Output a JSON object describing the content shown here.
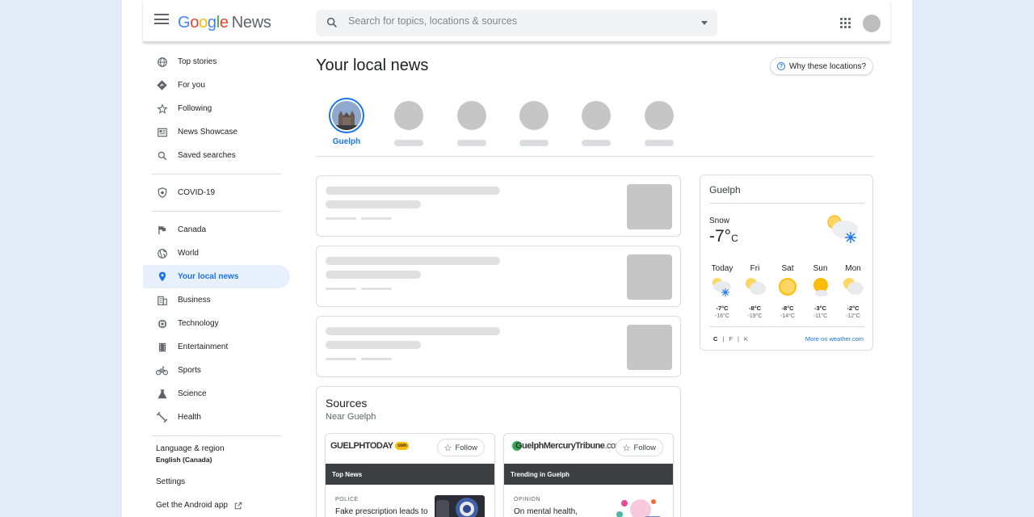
{
  "header": {
    "logo_letters": [
      "G",
      "o",
      "o",
      "g",
      "l",
      "e"
    ],
    "logo_suffix": "News",
    "search_placeholder": "Search for topics, locations & sources"
  },
  "sidebar": {
    "items": [
      {
        "label": "Top stories",
        "icon": "globe-icon"
      },
      {
        "label": "For you",
        "icon": "diamond-icon"
      },
      {
        "label": "Following",
        "icon": "star-icon"
      },
      {
        "label": "News Showcase",
        "icon": "newspaper-icon"
      },
      {
        "label": "Saved searches",
        "icon": "search-icon"
      }
    ],
    "covid": {
      "label": "COVID-19",
      "icon": "shield-icon"
    },
    "sections": [
      {
        "label": "Canada",
        "icon": "flag-icon"
      },
      {
        "label": "World",
        "icon": "world-icon"
      },
      {
        "label": "Your local news",
        "icon": "location-pin-icon",
        "active": true
      },
      {
        "label": "Business",
        "icon": "building-icon"
      },
      {
        "label": "Technology",
        "icon": "chip-icon"
      },
      {
        "label": "Entertainment",
        "icon": "film-icon"
      },
      {
        "label": "Sports",
        "icon": "bike-icon"
      },
      {
        "label": "Science",
        "icon": "flask-icon"
      },
      {
        "label": "Health",
        "icon": "dumbbell-icon"
      }
    ],
    "language_label": "Language & region",
    "language_value": "English (Canada)",
    "settings": "Settings",
    "android": "Get the Android app"
  },
  "main": {
    "title": "Your local news",
    "why_button": "Why these locations?",
    "selected_location": "Guelph"
  },
  "weather": {
    "city": "Guelph",
    "condition": "Snow",
    "temp": "-7°",
    "unit": "C",
    "days": [
      {
        "name": "Today",
        "hi": "-7°C",
        "lo": "-16°C",
        "icon": "snow-icon"
      },
      {
        "name": "Fri",
        "hi": "-8°C",
        "lo": "-19°C",
        "icon": "partly-cloudy-icon"
      },
      {
        "name": "Sat",
        "hi": "-8°C",
        "lo": "-14°C",
        "icon": "sunny-icon"
      },
      {
        "name": "Sun",
        "hi": "-3°C",
        "lo": "-11°C",
        "icon": "mostly-sunny-icon"
      },
      {
        "name": "Mon",
        "hi": "-2°C",
        "lo": "-12°C",
        "icon": "partly-cloudy-icon"
      }
    ],
    "units": [
      "C",
      "F",
      "K"
    ],
    "more_link": "More on weather.com"
  },
  "sources": {
    "title": "Sources",
    "subtitle": "Near Guelph",
    "cards": [
      {
        "logo": "GUELPHTODAY",
        "logo_badge": "com",
        "follow": "Follow",
        "band": "Top News",
        "kicker": "POLICE",
        "headline": "Fake prescription leads to"
      },
      {
        "logo": "GuelphMercuryTribune",
        "logo_suffix": ".com",
        "follow": "Follow",
        "band": "Trending in Guelph",
        "kicker": "OPINION",
        "headline": "On mental health,"
      }
    ]
  },
  "colors": {
    "accent": "#1a73e8",
    "background": "#e2ebf8",
    "active_bg": "#e8f0fe"
  }
}
